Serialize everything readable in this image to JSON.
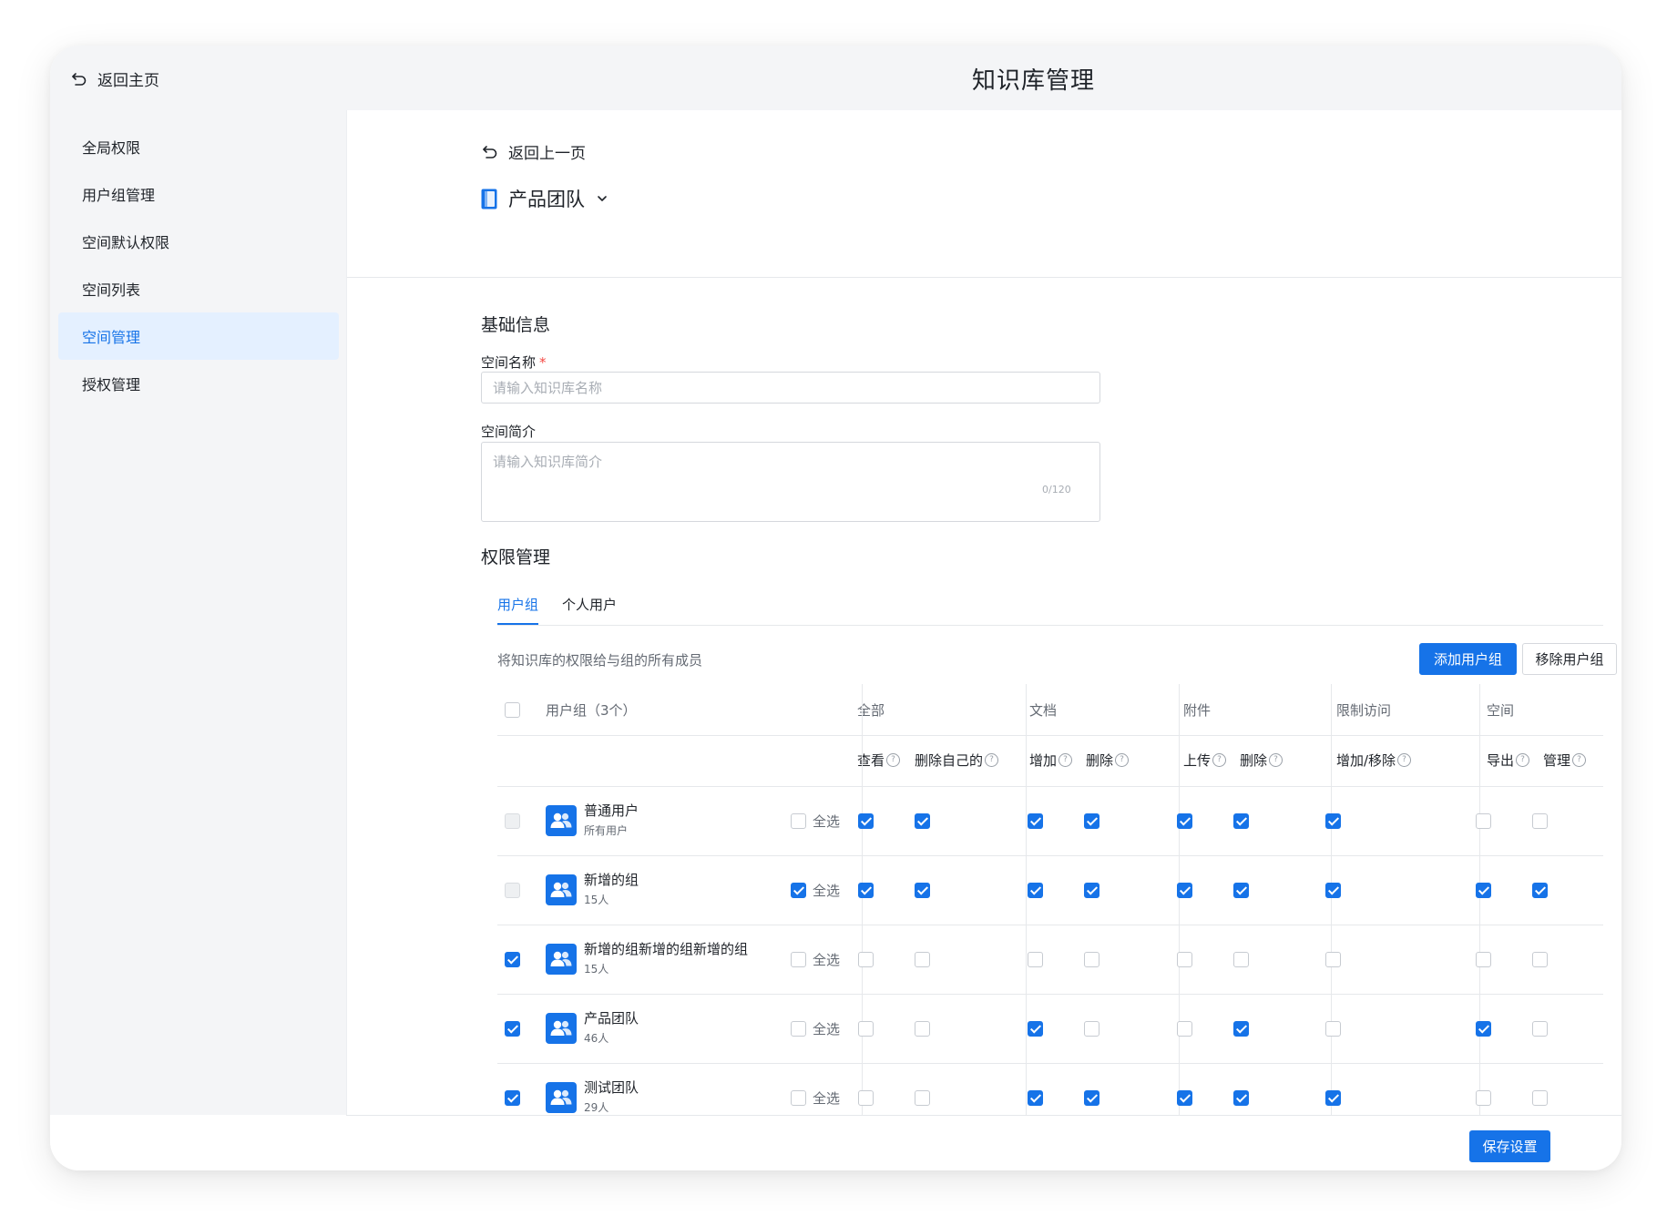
{
  "topbar": {
    "back_home": "返回主页",
    "title": "知识库管理"
  },
  "sidebar": {
    "items": [
      {
        "label": "全局权限",
        "active": false
      },
      {
        "label": "用户组管理",
        "active": false
      },
      {
        "label": "空间默认权限",
        "active": false
      },
      {
        "label": "空间列表",
        "active": false
      },
      {
        "label": "空间管理",
        "active": true
      },
      {
        "label": "授权管理",
        "active": false
      }
    ]
  },
  "header": {
    "back_prev": "返回上一页",
    "space_name": "产品团队"
  },
  "basic": {
    "title": "基础信息",
    "name_label": "空间名称",
    "name_required": "*",
    "name_placeholder": "请输入知识库名称",
    "desc_label": "空间简介",
    "desc_placeholder": "请输入知识库简介",
    "desc_count": "0/120"
  },
  "permissions": {
    "title": "权限管理",
    "tabs": [
      {
        "label": "用户组",
        "active": true
      },
      {
        "label": "个人用户",
        "active": false
      }
    ],
    "hint": "将知识库的权限给与组的所有成员",
    "add_button": "添加用户组",
    "remove_button": "移除用户组",
    "table": {
      "group_header": "用户组（3个）",
      "categories": [
        "全部",
        "文档",
        "附件",
        "限制访问",
        "空间"
      ],
      "sub_headers": [
        "查看",
        "删除自己的",
        "增加",
        "删除",
        "上传",
        "删除",
        "增加/移除",
        "导出",
        "管理"
      ],
      "select_all_label": "全选",
      "rows": [
        {
          "name": "普通用户",
          "sub": "所有用户",
          "row_check": "disabled",
          "select_all": false,
          "perms": [
            true,
            true,
            true,
            true,
            true,
            true,
            true,
            false,
            false
          ]
        },
        {
          "name": "新增的组",
          "sub": "15人",
          "row_check": "disabled",
          "select_all": true,
          "perms": [
            true,
            true,
            true,
            true,
            true,
            true,
            true,
            true,
            true
          ]
        },
        {
          "name": "新增的组新增的组新增的组",
          "sub": "15人",
          "row_check": "checked",
          "select_all": false,
          "perms": [
            false,
            false,
            false,
            false,
            false,
            false,
            false,
            false,
            false
          ]
        },
        {
          "name": "产品团队",
          "sub": "46人",
          "row_check": "checked",
          "select_all": false,
          "perms": [
            false,
            false,
            true,
            false,
            false,
            true,
            false,
            true,
            false
          ]
        },
        {
          "name": "测试团队",
          "sub": "29人",
          "row_check": "checked",
          "select_all": false,
          "perms": [
            false,
            false,
            true,
            true,
            true,
            true,
            true,
            false,
            false
          ]
        }
      ]
    }
  },
  "footer": {
    "save_button": "保存设置"
  },
  "colors": {
    "accent": "#1673e8",
    "sidebar_bg": "#f4f5f7",
    "active_bg": "#e4f0ff"
  }
}
